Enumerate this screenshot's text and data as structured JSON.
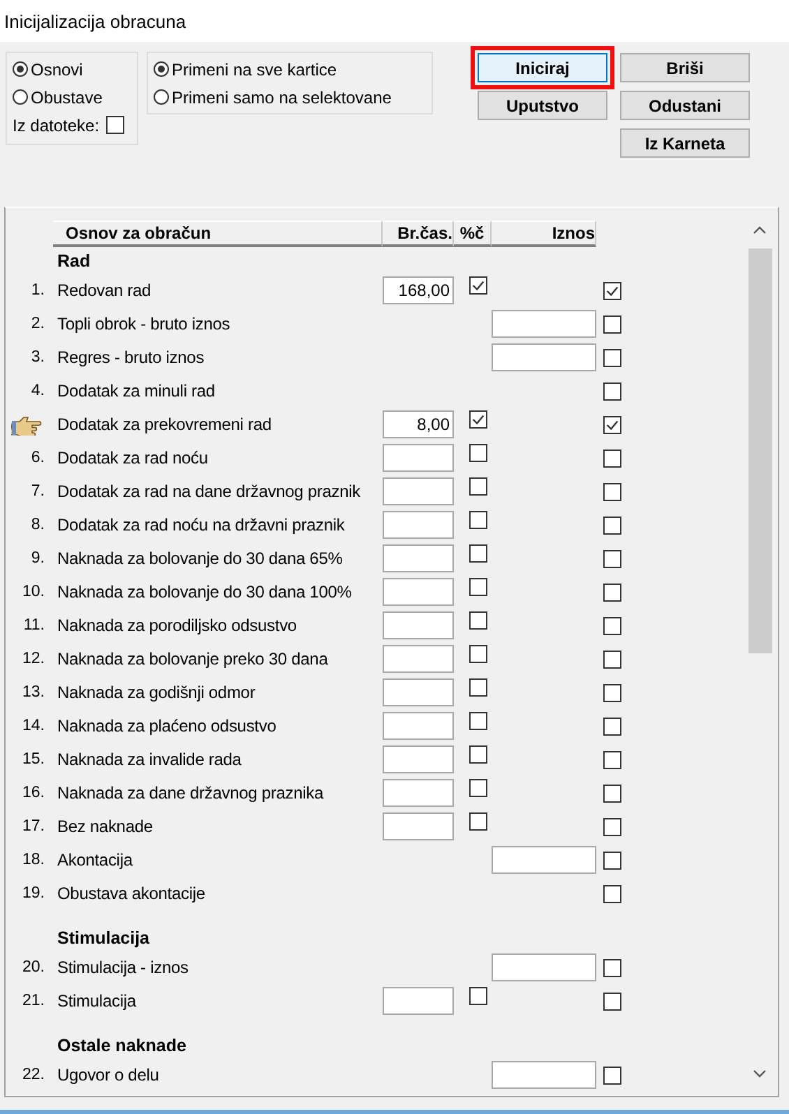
{
  "window": {
    "title": "Inicijalizacija obracuna"
  },
  "mode_options": [
    {
      "label": "Osnovi",
      "selected": true
    },
    {
      "label": "Obustave",
      "selected": false
    }
  ],
  "from_file": {
    "label": "Iz datoteke:",
    "checked": false
  },
  "scope_options": [
    {
      "label": "Primeni na sve kartice",
      "selected": true
    },
    {
      "label": "Primeni samo na selektovane",
      "selected": false
    }
  ],
  "button_columns": [
    [
      {
        "label": "Iniciraj",
        "focused": true
      },
      {
        "label": "Uputstvo",
        "focused": false
      }
    ],
    [
      {
        "label": "Briši",
        "focused": false
      },
      {
        "label": "Odustani",
        "focused": false
      },
      {
        "label": "Iz Karneta",
        "focused": false
      }
    ]
  ],
  "table": {
    "columns": [
      "Osnov za obračun",
      "Br.čas.",
      "%č",
      "Iznos"
    ],
    "groups": [
      {
        "title": "Rad",
        "rows": [
          {
            "number": "1.",
            "current": false,
            "label": "Redovan rad",
            "kind": "hours",
            "hours": "168,00",
            "percent_checked": true,
            "included": true
          },
          {
            "number": "2.",
            "current": false,
            "label": "Topli obrok - bruto iznos",
            "kind": "amount",
            "included": false
          },
          {
            "number": "3.",
            "current": false,
            "label": "Regres - bruto iznos",
            "kind": "amount",
            "included": false
          },
          {
            "number": "4.",
            "current": false,
            "label": "Dodatak za minuli rad",
            "kind": "plain",
            "included": false
          },
          {
            "current": true,
            "label": "Dodatak za prekovremeni rad",
            "kind": "hours",
            "hours": "8,00",
            "percent_checked": true,
            "included": true
          },
          {
            "number": "6.",
            "current": false,
            "label": "Dodatak za rad noću",
            "kind": "hours",
            "percent_checked": false,
            "included": false
          },
          {
            "number": "7.",
            "current": false,
            "label": "Dodatak za rad na dane državnog praznik",
            "kind": "hours",
            "percent_checked": false,
            "included": false
          },
          {
            "number": "8.",
            "current": false,
            "label": "Dodatak za rad noću na državni praznik",
            "kind": "hours",
            "percent_checked": false,
            "included": false
          },
          {
            "number": "9.",
            "current": false,
            "label": "Naknada za bolovanje do 30 dana 65%",
            "kind": "hours",
            "percent_checked": false,
            "included": false
          },
          {
            "number": "10.",
            "current": false,
            "label": "Naknada za bolovanje do 30 dana 100%",
            "kind": "hours",
            "percent_checked": false,
            "included": false
          },
          {
            "number": "11.",
            "current": false,
            "label": "Naknada za porodiljsko odsustvo",
            "kind": "hours",
            "percent_checked": false,
            "included": false
          },
          {
            "number": "12.",
            "current": false,
            "label": "Naknada za bolovanje preko 30 dana",
            "kind": "hours",
            "percent_checked": false,
            "included": false
          },
          {
            "number": "13.",
            "current": false,
            "label": "Naknada za godišnji odmor",
            "kind": "hours",
            "percent_checked": false,
            "included": false
          },
          {
            "number": "14.",
            "current": false,
            "label": "Naknada za plaćeno odsustvo",
            "kind": "hours",
            "percent_checked": false,
            "included": false
          },
          {
            "number": "15.",
            "current": false,
            "label": "Naknada za invalide rada",
            "kind": "hours",
            "percent_checked": false,
            "included": false
          },
          {
            "number": "16.",
            "current": false,
            "label": "Naknada za dane državnog praznika",
            "kind": "hours",
            "percent_checked": false,
            "included": false
          },
          {
            "number": "17.",
            "current": false,
            "label": "Bez naknade",
            "kind": "hours",
            "percent_checked": false,
            "included": false
          },
          {
            "number": "18.",
            "current": false,
            "label": "Akontacija",
            "kind": "amount",
            "included": false
          },
          {
            "number": "19.",
            "current": false,
            "label": "Obustava akontacije",
            "kind": "plain",
            "included": false
          }
        ]
      },
      {
        "title": "Stimulacija",
        "rows": [
          {
            "number": "20.",
            "current": false,
            "label": "Stimulacija - iznos",
            "kind": "amount",
            "included": false
          },
          {
            "number": "21.",
            "current": false,
            "label": "Stimulacija",
            "kind": "hours",
            "percent_checked": false,
            "included": false
          }
        ]
      },
      {
        "title": "Ostale naknade",
        "rows": [
          {
            "number": "22.",
            "current": false,
            "label": "Ugovor o delu",
            "kind": "amount",
            "included": false
          }
        ]
      }
    ]
  }
}
